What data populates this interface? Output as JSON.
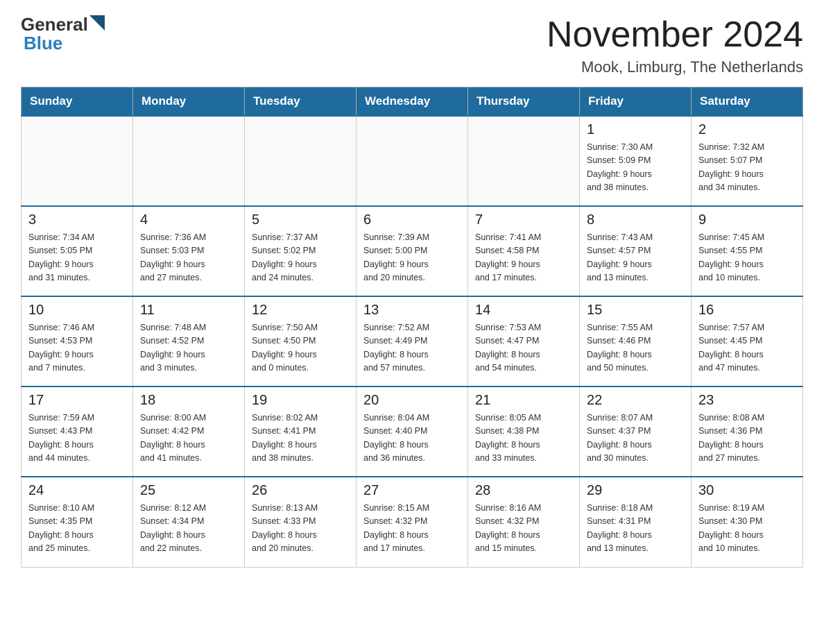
{
  "logo": {
    "general": "General",
    "blue_suffix": "▶",
    "blue": "Blue"
  },
  "header": {
    "title": "November 2024",
    "location": "Mook, Limburg, The Netherlands"
  },
  "days_of_week": [
    "Sunday",
    "Monday",
    "Tuesday",
    "Wednesday",
    "Thursday",
    "Friday",
    "Saturday"
  ],
  "weeks": [
    [
      {
        "day": "",
        "info": ""
      },
      {
        "day": "",
        "info": ""
      },
      {
        "day": "",
        "info": ""
      },
      {
        "day": "",
        "info": ""
      },
      {
        "day": "",
        "info": ""
      },
      {
        "day": "1",
        "info": "Sunrise: 7:30 AM\nSunset: 5:09 PM\nDaylight: 9 hours\nand 38 minutes."
      },
      {
        "day": "2",
        "info": "Sunrise: 7:32 AM\nSunset: 5:07 PM\nDaylight: 9 hours\nand 34 minutes."
      }
    ],
    [
      {
        "day": "3",
        "info": "Sunrise: 7:34 AM\nSunset: 5:05 PM\nDaylight: 9 hours\nand 31 minutes."
      },
      {
        "day": "4",
        "info": "Sunrise: 7:36 AM\nSunset: 5:03 PM\nDaylight: 9 hours\nand 27 minutes."
      },
      {
        "day": "5",
        "info": "Sunrise: 7:37 AM\nSunset: 5:02 PM\nDaylight: 9 hours\nand 24 minutes."
      },
      {
        "day": "6",
        "info": "Sunrise: 7:39 AM\nSunset: 5:00 PM\nDaylight: 9 hours\nand 20 minutes."
      },
      {
        "day": "7",
        "info": "Sunrise: 7:41 AM\nSunset: 4:58 PM\nDaylight: 9 hours\nand 17 minutes."
      },
      {
        "day": "8",
        "info": "Sunrise: 7:43 AM\nSunset: 4:57 PM\nDaylight: 9 hours\nand 13 minutes."
      },
      {
        "day": "9",
        "info": "Sunrise: 7:45 AM\nSunset: 4:55 PM\nDaylight: 9 hours\nand 10 minutes."
      }
    ],
    [
      {
        "day": "10",
        "info": "Sunrise: 7:46 AM\nSunset: 4:53 PM\nDaylight: 9 hours\nand 7 minutes."
      },
      {
        "day": "11",
        "info": "Sunrise: 7:48 AM\nSunset: 4:52 PM\nDaylight: 9 hours\nand 3 minutes."
      },
      {
        "day": "12",
        "info": "Sunrise: 7:50 AM\nSunset: 4:50 PM\nDaylight: 9 hours\nand 0 minutes."
      },
      {
        "day": "13",
        "info": "Sunrise: 7:52 AM\nSunset: 4:49 PM\nDaylight: 8 hours\nand 57 minutes."
      },
      {
        "day": "14",
        "info": "Sunrise: 7:53 AM\nSunset: 4:47 PM\nDaylight: 8 hours\nand 54 minutes."
      },
      {
        "day": "15",
        "info": "Sunrise: 7:55 AM\nSunset: 4:46 PM\nDaylight: 8 hours\nand 50 minutes."
      },
      {
        "day": "16",
        "info": "Sunrise: 7:57 AM\nSunset: 4:45 PM\nDaylight: 8 hours\nand 47 minutes."
      }
    ],
    [
      {
        "day": "17",
        "info": "Sunrise: 7:59 AM\nSunset: 4:43 PM\nDaylight: 8 hours\nand 44 minutes."
      },
      {
        "day": "18",
        "info": "Sunrise: 8:00 AM\nSunset: 4:42 PM\nDaylight: 8 hours\nand 41 minutes."
      },
      {
        "day": "19",
        "info": "Sunrise: 8:02 AM\nSunset: 4:41 PM\nDaylight: 8 hours\nand 38 minutes."
      },
      {
        "day": "20",
        "info": "Sunrise: 8:04 AM\nSunset: 4:40 PM\nDaylight: 8 hours\nand 36 minutes."
      },
      {
        "day": "21",
        "info": "Sunrise: 8:05 AM\nSunset: 4:38 PM\nDaylight: 8 hours\nand 33 minutes."
      },
      {
        "day": "22",
        "info": "Sunrise: 8:07 AM\nSunset: 4:37 PM\nDaylight: 8 hours\nand 30 minutes."
      },
      {
        "day": "23",
        "info": "Sunrise: 8:08 AM\nSunset: 4:36 PM\nDaylight: 8 hours\nand 27 minutes."
      }
    ],
    [
      {
        "day": "24",
        "info": "Sunrise: 8:10 AM\nSunset: 4:35 PM\nDaylight: 8 hours\nand 25 minutes."
      },
      {
        "day": "25",
        "info": "Sunrise: 8:12 AM\nSunset: 4:34 PM\nDaylight: 8 hours\nand 22 minutes."
      },
      {
        "day": "26",
        "info": "Sunrise: 8:13 AM\nSunset: 4:33 PM\nDaylight: 8 hours\nand 20 minutes."
      },
      {
        "day": "27",
        "info": "Sunrise: 8:15 AM\nSunset: 4:32 PM\nDaylight: 8 hours\nand 17 minutes."
      },
      {
        "day": "28",
        "info": "Sunrise: 8:16 AM\nSunset: 4:32 PM\nDaylight: 8 hours\nand 15 minutes."
      },
      {
        "day": "29",
        "info": "Sunrise: 8:18 AM\nSunset: 4:31 PM\nDaylight: 8 hours\nand 13 minutes."
      },
      {
        "day": "30",
        "info": "Sunrise: 8:19 AM\nSunset: 4:30 PM\nDaylight: 8 hours\nand 10 minutes."
      }
    ]
  ]
}
